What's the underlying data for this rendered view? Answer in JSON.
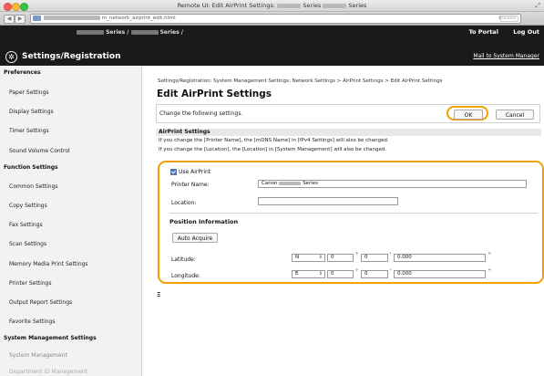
{
  "window": {
    "title_prefix": "Remote UI: Edit AirPrint Settings:",
    "title_series": "Series",
    "url": "m_network_airprint_edit.html",
    "reload_icon": "reload-icon",
    "reader_label": "Reader"
  },
  "header": {
    "printer_name": "Series /",
    "portal_link": "To Portal",
    "logout_link": "Log Out",
    "logo_icon": "settings-icon",
    "section_title": "Settings/Registration",
    "mail_link": "Mail to System Manager"
  },
  "sidebar": {
    "sections": [
      {
        "title": "Preferences",
        "items": [
          "Paper Settings",
          "Display Settings",
          "Timer Settings",
          "Sound Volume Control"
        ]
      },
      {
        "title": "Function Settings",
        "items": [
          "Common Settings",
          "Copy Settings",
          "Fax Settings",
          "Scan Settings",
          "Memory Media Print Settings",
          "Printer Settings",
          "Output Report Settings",
          "Favorite Settings"
        ]
      },
      {
        "title": "System Management Settings",
        "items": [
          "System Management",
          "Department ID Management"
        ]
      }
    ]
  },
  "main": {
    "breadcrumb": "Settings/Registration: System Management Settings: Network Settings > AirPrint Settings > Edit AirPrint Settings",
    "page_title": "Edit AirPrint Settings",
    "instruction": "Change the following settings.",
    "ok_label": "OK",
    "cancel_label": "Cancel",
    "section_title": "AirPrint Settings",
    "note1": "If you change the [Printer Name], the [mDNS Name] in [IPv4 Settings] will also be changed.",
    "note2": "If you change the [Location], the [Location] in [System Management] will also be changed.",
    "use_airprint_label": "Use AirPrint",
    "use_airprint_checked": true,
    "printer_name_label": "Printer Name:",
    "printer_name_value_prefix": "Canon",
    "printer_name_value_suffix": "Series",
    "location_label": "Location:",
    "location_value": "",
    "position_title": "Position Information",
    "auto_acquire_label": "Auto Acquire",
    "latitude": {
      "label": "Latitude:",
      "direction": "N",
      "degrees": "0",
      "minutes": "0",
      "seconds": "0.000"
    },
    "longitude": {
      "label": "Longitude:",
      "direction": "E",
      "degrees": "0",
      "minutes": "0",
      "seconds": "0.000"
    },
    "unit_deg": "°",
    "unit_min": "'",
    "unit_sec": "\"",
    "bottom_symbol": "Ξ"
  },
  "colors": {
    "highlight": "#f0a000",
    "header_bg": "#1a1a1a"
  }
}
